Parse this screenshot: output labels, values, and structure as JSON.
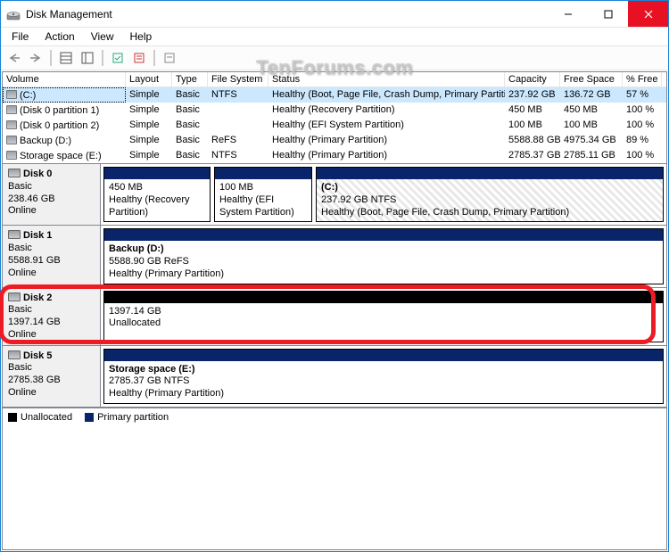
{
  "window": {
    "title": "Disk Management"
  },
  "menubar": {
    "items": [
      "File",
      "Action",
      "View",
      "Help"
    ]
  },
  "volumes": {
    "columns": [
      "Volume",
      "Layout",
      "Type",
      "File System",
      "Status",
      "Capacity",
      "Free Space",
      "% Free"
    ],
    "rows": [
      {
        "selected": true,
        "volume": "(C:)",
        "layout": "Simple",
        "type": "Basic",
        "fs": "NTFS",
        "status": "Healthy (Boot, Page File, Crash Dump, Primary Partition)",
        "capacity": "237.92 GB",
        "free": "136.72 GB",
        "pct": "57 %"
      },
      {
        "volume": "(Disk 0 partition 1)",
        "layout": "Simple",
        "type": "Basic",
        "fs": "",
        "status": "Healthy (Recovery Partition)",
        "capacity": "450 MB",
        "free": "450 MB",
        "pct": "100 %"
      },
      {
        "volume": "(Disk 0 partition 2)",
        "layout": "Simple",
        "type": "Basic",
        "fs": "",
        "status": "Healthy (EFI System Partition)",
        "capacity": "100 MB",
        "free": "100 MB",
        "pct": "100 %"
      },
      {
        "volume": "Backup (D:)",
        "layout": "Simple",
        "type": "Basic",
        "fs": "ReFS",
        "status": "Healthy (Primary Partition)",
        "capacity": "5588.88 GB",
        "free": "4975.34 GB",
        "pct": "89 %"
      },
      {
        "volume": "Storage space (E:)",
        "layout": "Simple",
        "type": "Basic",
        "fs": "NTFS",
        "status": "Healthy (Primary Partition)",
        "capacity": "2785.37 GB",
        "free": "2785.11 GB",
        "pct": "100 %"
      }
    ]
  },
  "disks": [
    {
      "name": "Disk 0",
      "type": "Basic",
      "size": "238.46 GB",
      "state": "Online",
      "parts": [
        {
          "flex": "0 0 120px",
          "stripe": "blue",
          "line1": "",
          "line2": "450 MB",
          "line3": "Healthy (Recovery Partition)"
        },
        {
          "flex": "0 0 110px",
          "stripe": "blue",
          "line1": "",
          "line2": "100 MB",
          "line3": "Healthy (EFI System Partition)"
        },
        {
          "flex": "1",
          "stripe": "blue",
          "selected": true,
          "line1": "(C:)",
          "line2": "237.92 GB NTFS",
          "line3": "Healthy (Boot, Page File, Crash Dump, Primary Partition)"
        }
      ]
    },
    {
      "name": "Disk 1",
      "type": "Basic",
      "size": "5588.91 GB",
      "state": "Online",
      "parts": [
        {
          "flex": "1",
          "stripe": "blue",
          "line1": "Backup  (D:)",
          "line2": "5588.90 GB ReFS",
          "line3": "Healthy (Primary Partition)"
        }
      ]
    },
    {
      "name": "Disk 2",
      "type": "Basic",
      "size": "1397.14 GB",
      "state": "Online",
      "highlight": true,
      "parts": [
        {
          "flex": "1",
          "stripe": "black",
          "line1": "",
          "line2": "1397.14 GB",
          "line3": "Unallocated"
        }
      ]
    },
    {
      "name": "Disk 5",
      "type": "Basic",
      "size": "2785.38 GB",
      "state": "Online",
      "parts": [
        {
          "flex": "1",
          "stripe": "blue",
          "line1": "Storage space  (E:)",
          "line2": "2785.37 GB NTFS",
          "line3": "Healthy (Primary Partition)"
        }
      ]
    }
  ],
  "legend": {
    "unallocated": "Unallocated",
    "primary": "Primary partition"
  },
  "watermark": "TenForums.com"
}
